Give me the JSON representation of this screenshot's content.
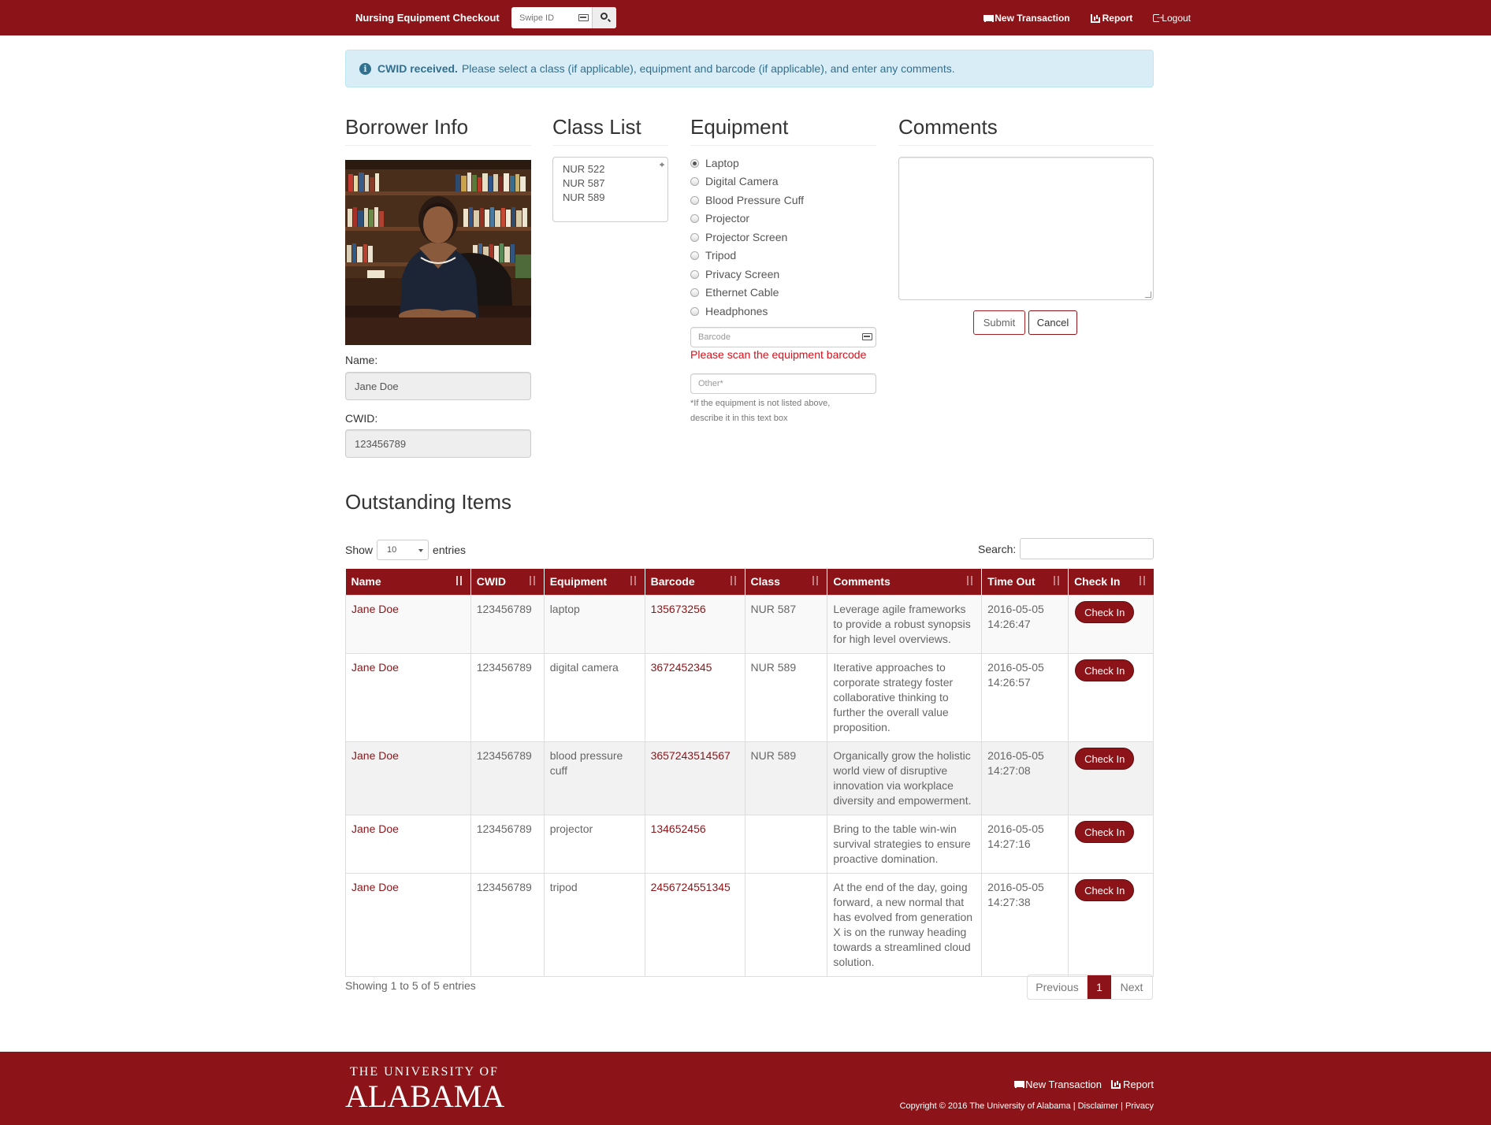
{
  "navbar": {
    "brand": "Nursing Equipment Checkout",
    "swipe_placeholder": "Swipe ID",
    "links": [
      {
        "label": "New Transaction",
        "icon": "cart-icon"
      },
      {
        "label": "Report",
        "icon": "bar-chart-icon"
      },
      {
        "label": "Logout",
        "icon": "logout-icon"
      }
    ]
  },
  "alert": {
    "bold": "CWID received.",
    "text": "Please select a class (if applicable), equipment and barcode (if applicable), and enter any comments."
  },
  "borrower": {
    "heading": "Borrower Info",
    "name_label": "Name:",
    "name_value": "Jane Doe",
    "cwid_label": "CWID:",
    "cwid_value": "123456789"
  },
  "class_list": {
    "heading": "Class List",
    "items": [
      "NUR 522",
      "NUR 587",
      "NUR 589"
    ]
  },
  "equipment": {
    "heading": "Equipment",
    "options": [
      "Laptop",
      "Digital Camera",
      "Blood Pressure Cuff",
      "Projector",
      "Projector Screen",
      "Tripod",
      "Privacy Screen",
      "Ethernet Cable",
      "Headphones"
    ],
    "selected": "Laptop",
    "barcode_placeholder": "Barcode",
    "barcode_error": "Please scan the equipment barcode",
    "other_placeholder": "Other*",
    "help_text": "*If the equipment is not listed above, describe it in this text box"
  },
  "comments": {
    "heading": "Comments",
    "submit_label": "Submit",
    "cancel_label": "Cancel"
  },
  "outstanding": {
    "heading": "Outstanding Items",
    "show_label": "Show",
    "entries_value": "10",
    "entries_label": "entries",
    "search_label": "Search:",
    "columns": [
      "Name",
      "CWID",
      "Equipment",
      "Barcode",
      "Class",
      "Comments",
      "Time Out",
      "Check In"
    ],
    "rows": [
      {
        "name": "Jane Doe",
        "cwid": "123456789",
        "equipment": "laptop",
        "barcode": "135673256",
        "class": "NUR 587",
        "comments": "Leverage agile frameworks to provide a robust synopsis for high level overviews.",
        "time_out": "2016-05-05 14:26:47",
        "action": "Check In"
      },
      {
        "name": "Jane Doe",
        "cwid": "123456789",
        "equipment": "digital camera",
        "barcode": "3672452345",
        "class": "NUR 589",
        "comments": "Iterative approaches to corporate strategy foster collaborative thinking to further the overall value proposition.",
        "time_out": "2016-05-05 14:26:57",
        "action": "Check In"
      },
      {
        "name": "Jane Doe",
        "cwid": "123456789",
        "equipment": "blood pressure cuff",
        "barcode": "3657243514567",
        "class": "NUR 589",
        "comments": "Organically grow the holistic world view of disruptive innovation via workplace diversity and empowerment.",
        "time_out": "2016-05-05 14:27:08",
        "action": "Check In"
      },
      {
        "name": "Jane Doe",
        "cwid": "123456789",
        "equipment": "projector",
        "barcode": "134652456",
        "class": "",
        "comments": "Bring to the table win-win survival strategies to ensure proactive domination.",
        "time_out": "2016-05-05 14:27:16",
        "action": "Check In"
      },
      {
        "name": "Jane Doe",
        "cwid": "123456789",
        "equipment": "tripod",
        "barcode": "2456724551345",
        "class": "",
        "comments": "At the end of the day, going forward, a new normal that has evolved from generation X is on the runway heading towards a streamlined cloud solution.",
        "time_out": "2016-05-05 14:27:38",
        "action": "Check In"
      }
    ],
    "summary": "Showing 1 to 5 of 5 entries",
    "pager": {
      "previous": "Previous",
      "current": "1",
      "next": "Next"
    }
  },
  "footer": {
    "logo_line1": "THE UNIVERSITY OF",
    "logo_line2": "ALABAMA",
    "links": [
      {
        "label": "New Transaction",
        "icon": "cart-icon"
      },
      {
        "label": "Report",
        "icon": "bar-chart-icon"
      }
    ],
    "copyright": "Copyright © 2016 The University of Alabama",
    "sep": "|",
    "disclaimer": "Disclaimer",
    "privacy": "Privacy"
  },
  "colors": {
    "brand": "#8c1418",
    "alert_bg": "#d9edf7",
    "alert_text": "#31708f",
    "error": "#d6111a"
  }
}
